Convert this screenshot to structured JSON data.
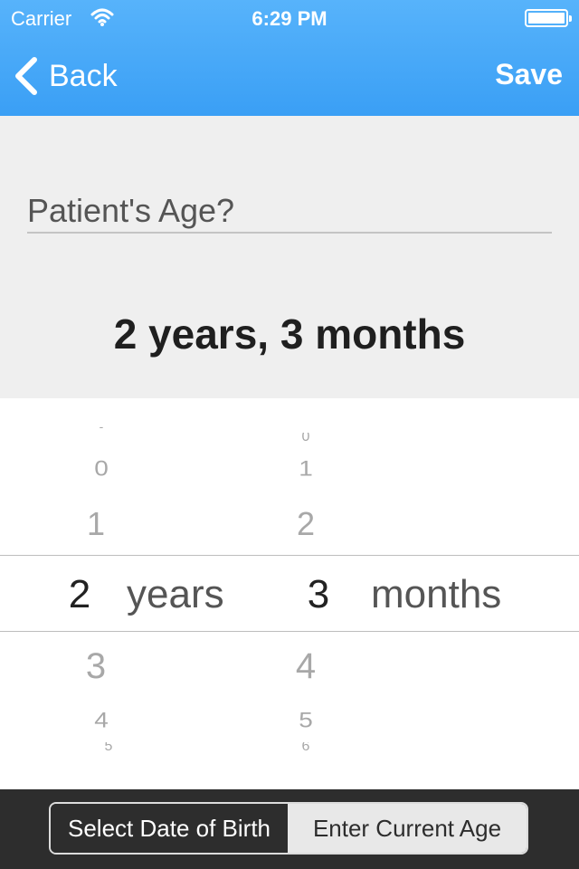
{
  "status_bar": {
    "carrier": "Carrier",
    "time": "6:29 PM"
  },
  "nav": {
    "back_label": "Back",
    "save_label": "Save",
    "accent": "#3a9ff5"
  },
  "question": {
    "label": "Patient's Age?"
  },
  "age_display": "2 years, 3 months",
  "picker": {
    "years_wheel": [
      "-",
      "0",
      "1",
      "2",
      "3",
      "4",
      "5"
    ],
    "years_selected": "2",
    "years_unit": "years",
    "months_wheel": [
      "0",
      "1",
      "2",
      "3",
      "4",
      "5",
      "6"
    ],
    "months_selected": "3",
    "months_unit": "months"
  },
  "toolbar": {
    "segments": [
      "Select Date of Birth",
      "Enter Current Age"
    ],
    "selected_segment": "Select Date of Birth"
  }
}
